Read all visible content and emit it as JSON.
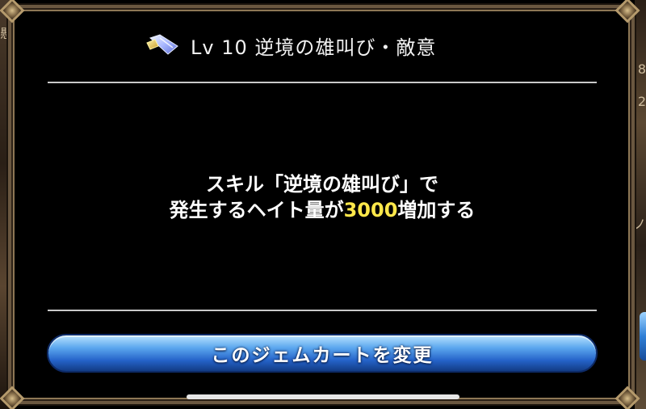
{
  "dialog": {
    "title": "Lv 10 逆境の雄叫び・敵意",
    "description_line1": "スキル「逆境の雄叫び」で",
    "description_line2_prefix": "発生するヘイト量が",
    "description_highlight": "3000",
    "description_line2_suffix": "増加する",
    "change_button_label": "このジェムカートを変更",
    "gem_icon": "gem-cart-icon"
  },
  "background_edges": {
    "left_glyph": "懸",
    "right_glyph_1": "8",
    "right_glyph_2": "2",
    "right_glyph_3": "ノ"
  },
  "colors": {
    "highlight": "#ffe84a",
    "button_blue": "#2563c9",
    "text": "#ffffff"
  }
}
